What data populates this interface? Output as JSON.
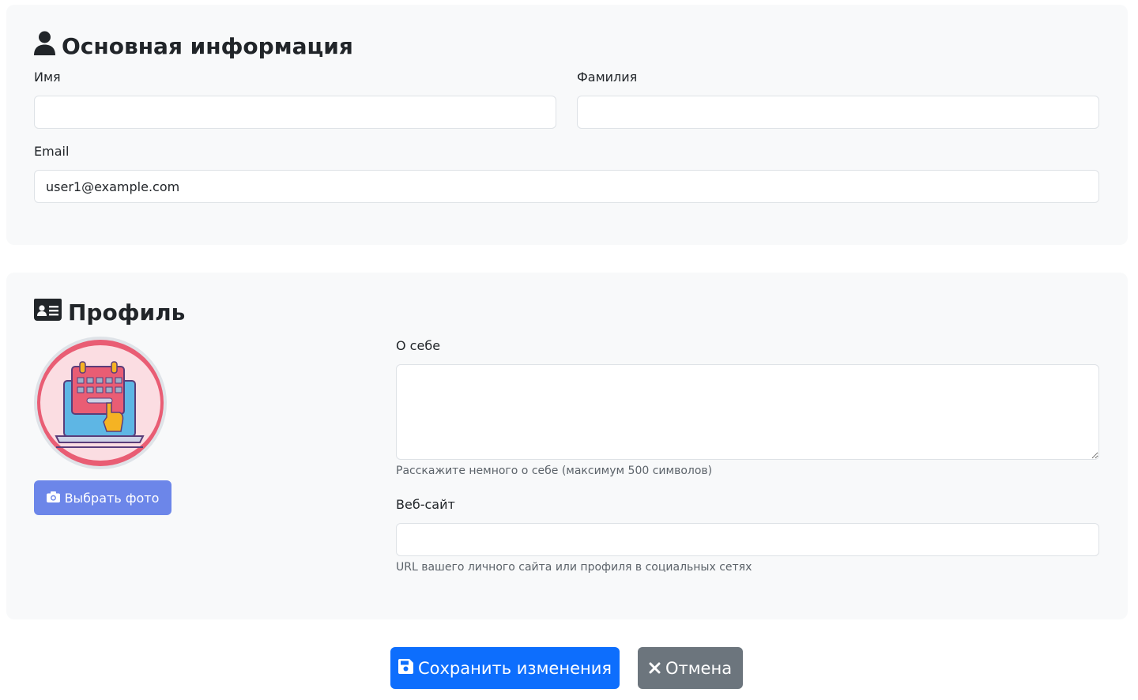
{
  "basic_info": {
    "title": "Основная информация",
    "icon": "user-icon",
    "first_name": {
      "label": "Имя",
      "value": "",
      "placeholder": ""
    },
    "last_name": {
      "label": "Фамилия",
      "value": "",
      "placeholder": ""
    },
    "email": {
      "label": "Email",
      "value": "user1@example.com"
    }
  },
  "profile": {
    "title": "Профиль",
    "icon": "id-card-icon",
    "avatar_icon": "calendar-laptop-illustration",
    "choose_photo_label": "Выбрать фото",
    "choose_photo_icon": "camera-icon",
    "about": {
      "label": "О себе",
      "value": "",
      "help": "Расскажите немного о себе (максимум 500 символов)"
    },
    "website": {
      "label": "Веб-сайт",
      "value": "",
      "help": "URL вашего личного сайта или профиля в социальных сетях"
    }
  },
  "actions": {
    "save_label": "Сохранить изменения",
    "save_icon": "floppy-disk-icon",
    "cancel_label": "Отмена",
    "cancel_icon": "close-icon"
  },
  "colors": {
    "section_bg": "#f8f9fa",
    "primary": "#0d6efd",
    "secondary": "#6c757d",
    "photo_button": "#6c86e9"
  }
}
